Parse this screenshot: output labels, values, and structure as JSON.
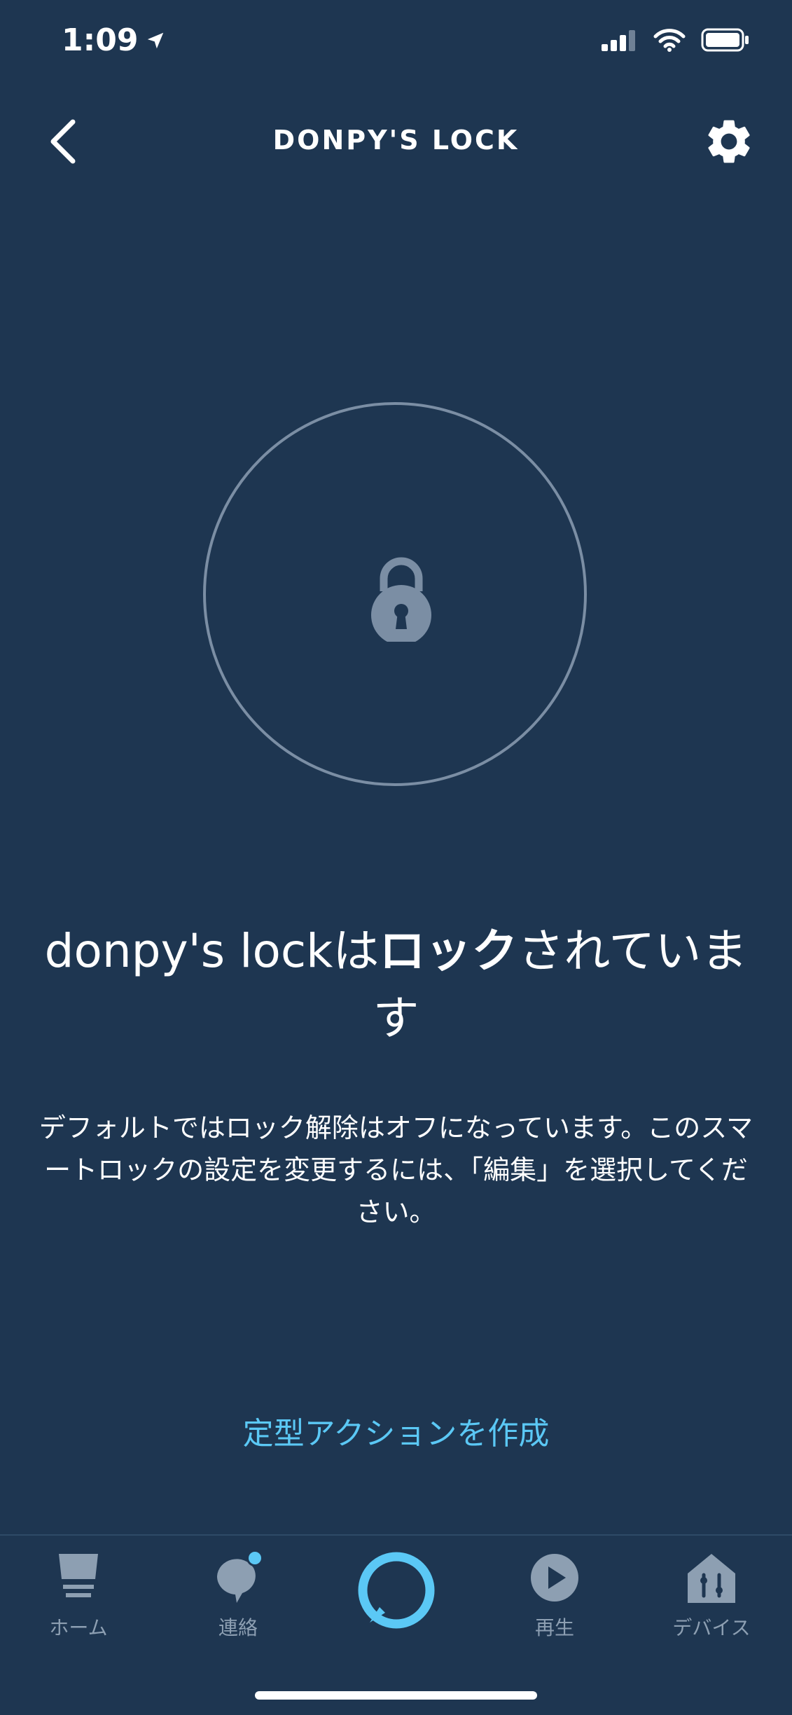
{
  "status_bar": {
    "time": "1:09"
  },
  "header": {
    "title": "DONPY'S LOCK"
  },
  "lock": {
    "state": "locked"
  },
  "status": {
    "heading_prefix": "donpy's lockは",
    "heading_bold": "ロック",
    "heading_suffix": "されています",
    "description": "デフォルトではロック解除はオフになっています。このスマートロックの設定を変更するには、「編集」を選択してください。"
  },
  "create_routine_label": "定型アクションを作成",
  "bottom_nav": {
    "home_label": "ホーム",
    "communicate_label": "連絡",
    "play_label": "再生",
    "devices_label": "デバイス"
  },
  "colors": {
    "background": "#1e3651",
    "accent": "#5bc8f5",
    "muted": "#8d9fb2",
    "circle_border": "#7b8ea4"
  }
}
